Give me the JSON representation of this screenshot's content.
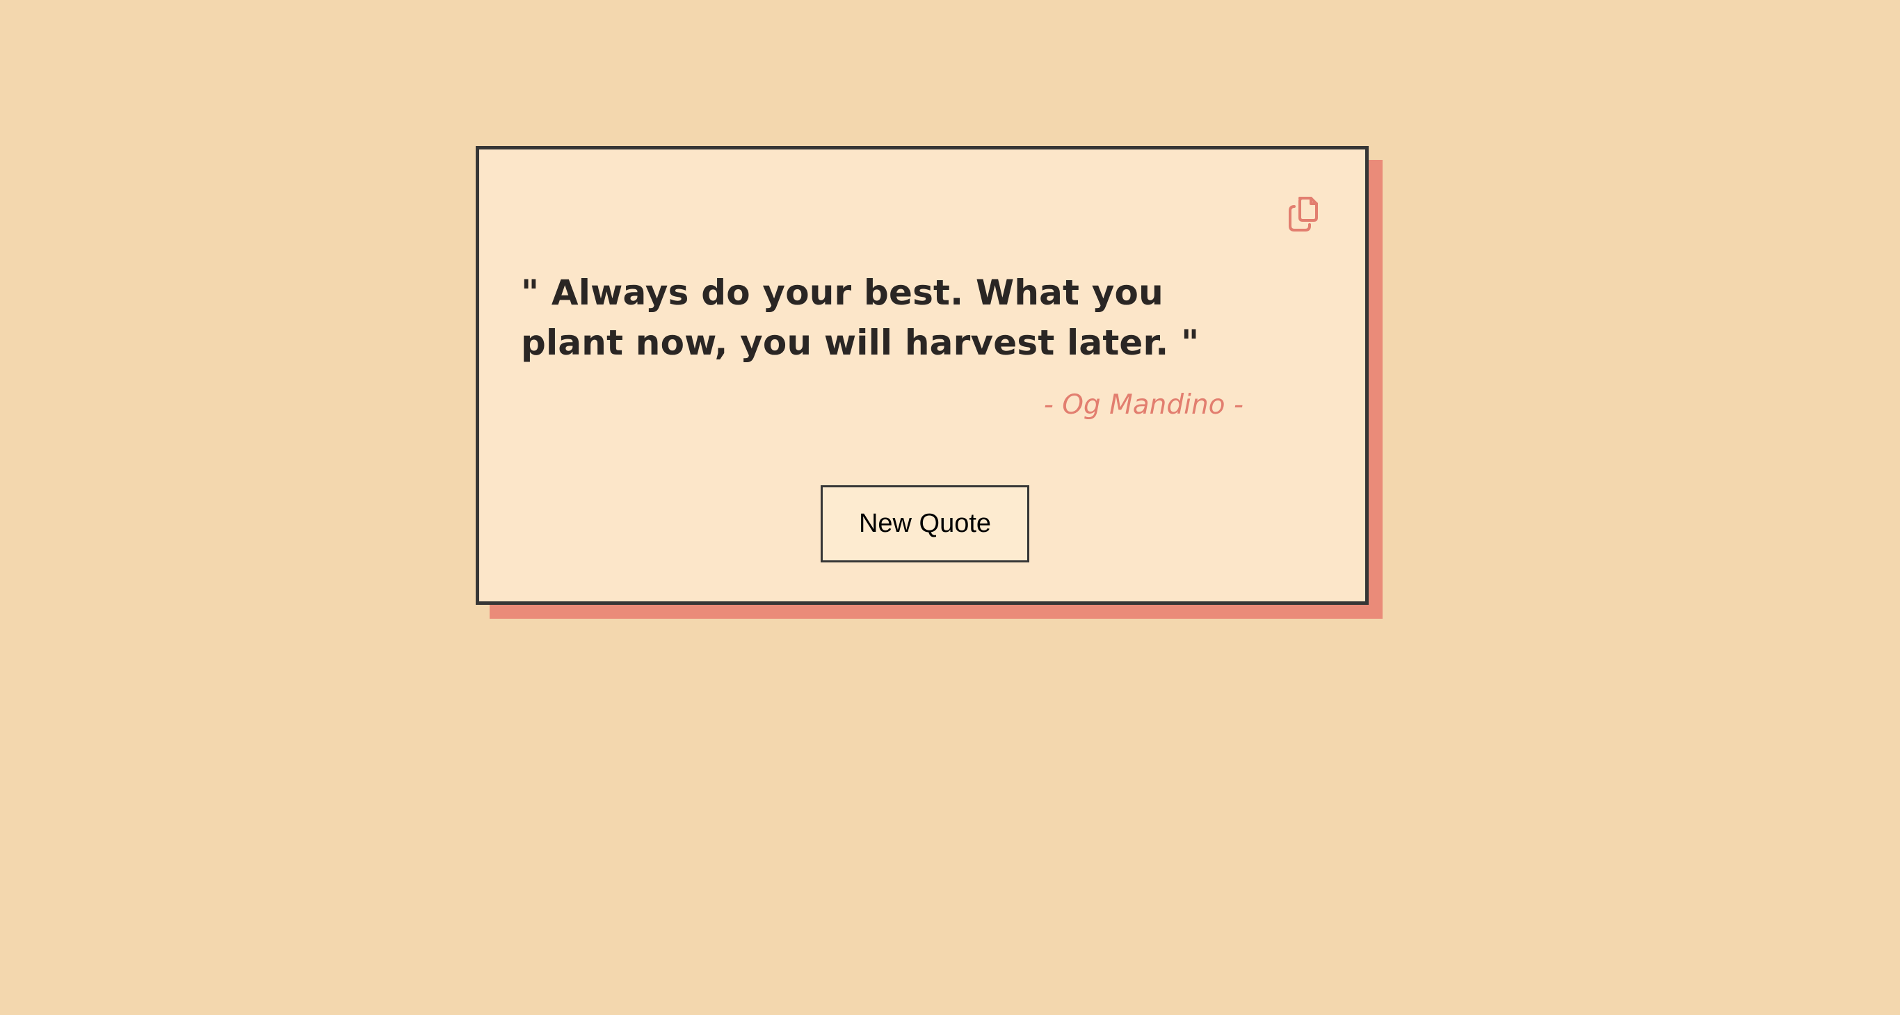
{
  "quote": {
    "text": "\" Always do your best. What you plant now, you will harvest later. \"",
    "author": "- Og Mandino -"
  },
  "actions": {
    "copy_icon": "copy-icon",
    "new_quote_label": "New Quote"
  },
  "colors": {
    "background": "#f3d7ae",
    "card": "#fce6c9",
    "shadow": "#ea8b79",
    "accent": "#e27e6f",
    "border": "#363636"
  }
}
